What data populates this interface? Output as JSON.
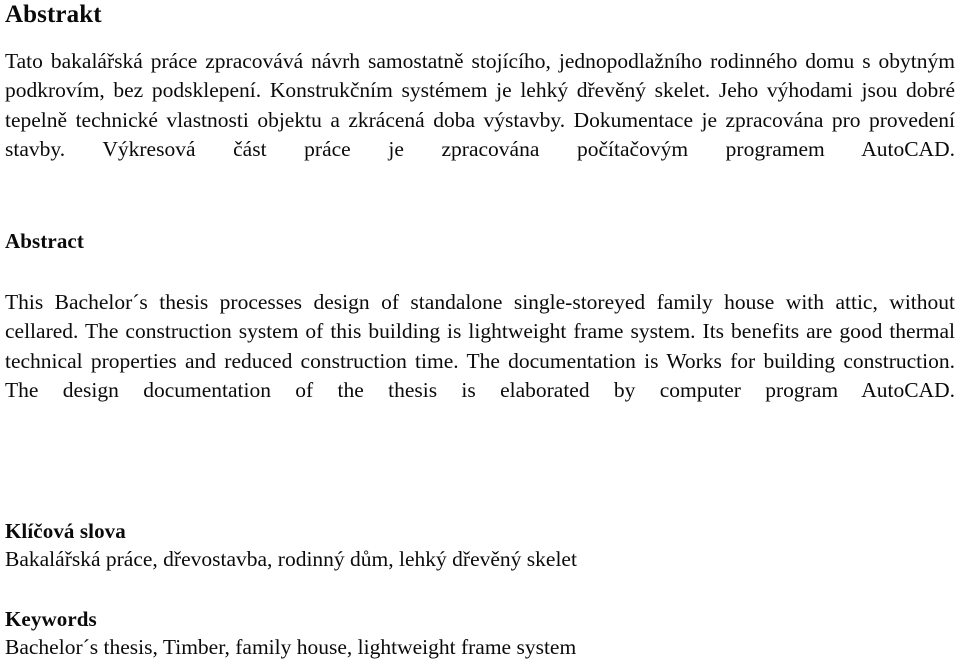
{
  "document": {
    "language_primary": "cs",
    "language_secondary": "en",
    "text_color": "#0a0a0a",
    "background_color": "#ffffff"
  },
  "abstrakt": {
    "heading": "Abstrakt",
    "body": "Tato bakalářská práce zpracovává návrh samostatně stojícího, jednopodlažního rodinného domu s obytným podkrovím, bez podsklepení. Konstrukčním systémem je lehký dřevěný skelet. Jeho výhodami jsou dobré tepelně technické vlastnosti objektu a zkrácená doba výstavby. Dokumentace je zpracována pro provedení stavby. Výkresová část práce je zpracována počítačovým programem AutoCAD."
  },
  "abstract": {
    "heading": "Abstract",
    "body": "This Bachelor´s thesis processes design of standalone single-storeyed family house with attic, without cellared. The construction system of this building is lightweight frame system. Its benefits are good thermal technical properties and reduced construction time. The documentation is Works for building construction. The design documentation of the thesis is elaborated by computer program AutoCAD."
  },
  "klicova_slova": {
    "heading": "Klíčová slova",
    "body": "Bakalářská práce, dřevostavba, rodinný dům, lehký dřevěný skelet",
    "terms": [
      "Bakalářská práce",
      "dřevostavba",
      "rodinný dům",
      "lehký dřevěný skelet"
    ]
  },
  "keywords": {
    "heading": "Keywords",
    "body": "Bachelor´s thesis, Timber, family house, lightweight frame system",
    "terms": [
      "Bachelor´s thesis",
      "Timber",
      "family house",
      "lightweight frame system"
    ]
  }
}
